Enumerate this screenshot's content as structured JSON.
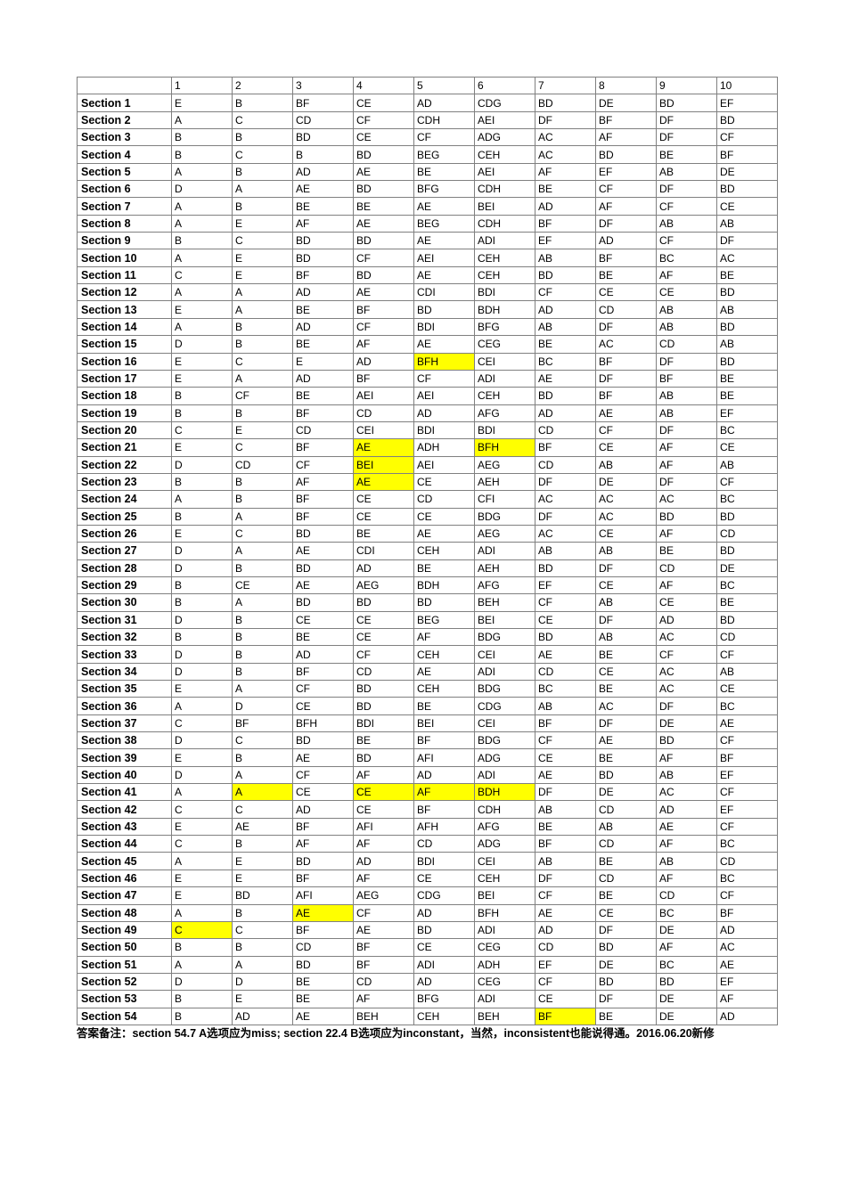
{
  "sheet": {
    "corner_label": "",
    "columns": [
      "1",
      "2",
      "3",
      "4",
      "5",
      "6",
      "7",
      "8",
      "9",
      "10"
    ],
    "highlight_color": "#ffff00",
    "rows": [
      {
        "label": "Section 1",
        "cells": [
          "E",
          "B",
          "BF",
          "CE",
          "AD",
          "CDG",
          "BD",
          "DE",
          "BD",
          "EF"
        ]
      },
      {
        "label": "Section 2",
        "cells": [
          "A",
          "C",
          "CD",
          "CF",
          "CDH",
          "AEI",
          "DF",
          "BF",
          "DF",
          "BD"
        ]
      },
      {
        "label": "Section 3",
        "cells": [
          "B",
          "B",
          "BD",
          "CE",
          "CF",
          "ADG",
          "AC",
          "AF",
          "DF",
          "CF"
        ]
      },
      {
        "label": "Section 4",
        "cells": [
          "B",
          "C",
          "B",
          "BD",
          "BEG",
          "CEH",
          "AC",
          "BD",
          "BE",
          "BF"
        ]
      },
      {
        "label": "Section 5",
        "cells": [
          "A",
          "B",
          "AD",
          "AE",
          "BE",
          "AEI",
          "AF",
          "EF",
          "AB",
          "DE"
        ]
      },
      {
        "label": "Section 6",
        "cells": [
          "D",
          "A",
          "AE",
          "BD",
          "BFG",
          "CDH",
          "BE",
          "CF",
          "DF",
          "BD"
        ]
      },
      {
        "label": "Section 7",
        "cells": [
          "A",
          "B",
          "BE",
          "BE",
          "AE",
          "BEI",
          "AD",
          "AF",
          "CF",
          "CE"
        ]
      },
      {
        "label": "Section 8",
        "cells": [
          "A",
          "E",
          "AF",
          "AE",
          "BEG",
          "CDH",
          "BF",
          "DF",
          "AB",
          "AB"
        ]
      },
      {
        "label": "Section 9",
        "cells": [
          "B",
          "C",
          "BD",
          "BD",
          "AE",
          "ADI",
          "EF",
          "AD",
          "CF",
          "DF"
        ]
      },
      {
        "label": "Section 10",
        "cells": [
          "A",
          "E",
          "BD",
          "CF",
          "AEI",
          "CEH",
          "AB",
          "BF",
          "BC",
          "AC"
        ]
      },
      {
        "label": "Section 11",
        "cells": [
          "C",
          "E",
          "BF",
          "BD",
          "AE",
          "CEH",
          "BD",
          "BE",
          "AF",
          "BE"
        ]
      },
      {
        "label": "Section 12",
        "cells": [
          "A",
          "A",
          "AD",
          "AE",
          "CDI",
          "BDI",
          "CF",
          "CE",
          "CE",
          "BD"
        ]
      },
      {
        "label": "Section 13",
        "cells": [
          "E",
          "A",
          "BE",
          "BF",
          "BD",
          "BDH",
          "AD",
          "CD",
          "AB",
          "AB"
        ]
      },
      {
        "label": "Section 14",
        "cells": [
          "A",
          "B",
          "AD",
          "CF",
          "BDI",
          "BFG",
          "AB",
          "DF",
          "AB",
          "BD"
        ]
      },
      {
        "label": "Section 15",
        "cells": [
          "D",
          "B",
          "BE",
          "AF",
          "AE",
          "CEG",
          "BE",
          "AC",
          "CD",
          "AB"
        ]
      },
      {
        "label": "Section 16",
        "cells": [
          "E",
          "C",
          "E",
          "AD",
          "BFH",
          "CEI",
          "BC",
          "BF",
          "DF",
          "BD"
        ]
      },
      {
        "label": "Section 17",
        "cells": [
          "E",
          "A",
          "AD",
          "BF",
          "CF",
          "ADI",
          "AE",
          "DF",
          "BF",
          "BE"
        ]
      },
      {
        "label": "Section 18",
        "cells": [
          "B",
          "CF",
          "BE",
          "AEI",
          "AEI",
          "CEH",
          "BD",
          "BF",
          "AB",
          "BE"
        ]
      },
      {
        "label": "Section 19",
        "cells": [
          "B",
          "B",
          "BF",
          "CD",
          "AD",
          "AFG",
          "AD",
          "AE",
          "AB",
          "EF"
        ]
      },
      {
        "label": "Section 20",
        "cells": [
          "C",
          "E",
          "CD",
          "CEI",
          "BDI",
          "BDI",
          "CD",
          "CF",
          "DF",
          "BC"
        ]
      },
      {
        "label": "Section 21",
        "cells": [
          "E",
          "C",
          "BF",
          "AE",
          "ADH",
          "BFH",
          "BF",
          "CE",
          "AF",
          "CE"
        ]
      },
      {
        "label": "Section 22",
        "cells": [
          "D",
          "CD",
          "CF",
          "BEI",
          "AEI",
          "AEG",
          "CD",
          "AB",
          "AF",
          "AB"
        ]
      },
      {
        "label": "Section 23",
        "cells": [
          "B",
          "B",
          "AF",
          "AE",
          "CE",
          "AEH",
          "DF",
          "DE",
          "DF",
          "CF"
        ]
      },
      {
        "label": "Section 24",
        "cells": [
          "A",
          "B",
          "BF",
          "CE",
          "CD",
          "CFI",
          "AC",
          "AC",
          "AC",
          "BC"
        ]
      },
      {
        "label": "Section 25",
        "cells": [
          "B",
          "A",
          "BF",
          "CE",
          "CE",
          "BDG",
          "DF",
          "AC",
          "BD",
          "BD"
        ]
      },
      {
        "label": "Section 26",
        "cells": [
          "E",
          "C",
          "BD",
          "BE",
          "AE",
          "AEG",
          "AC",
          "CE",
          "AF",
          "CD"
        ]
      },
      {
        "label": "Section 27",
        "cells": [
          "D",
          "A",
          "AE",
          "CDI",
          "CEH",
          "ADI",
          "AB",
          "AB",
          "BE",
          "BD"
        ]
      },
      {
        "label": "Section 28",
        "cells": [
          "D",
          "B",
          "BD",
          "AD",
          "BE",
          "AEH",
          "BD",
          "DF",
          "CD",
          "DE"
        ]
      },
      {
        "label": "Section 29",
        "cells": [
          "B",
          "CE",
          "AE",
          "AEG",
          "BDH",
          "AFG",
          "EF",
          "CE",
          "AF",
          "BC"
        ]
      },
      {
        "label": "Section 30",
        "cells": [
          "B",
          "A",
          "BD",
          "BD",
          "BD",
          "BEH",
          "CF",
          "AB",
          "CE",
          "BE"
        ]
      },
      {
        "label": "Section 31",
        "cells": [
          "D",
          "B",
          "CE",
          "CE",
          "BEG",
          "BEI",
          "CE",
          "DF",
          "AD",
          "BD"
        ]
      },
      {
        "label": "Section 32",
        "cells": [
          "B",
          "B",
          "BE",
          "CE",
          "AF",
          "BDG",
          "BD",
          "AB",
          "AC",
          "CD"
        ]
      },
      {
        "label": "Section 33",
        "cells": [
          "D",
          "B",
          "AD",
          "CF",
          "CEH",
          "CEI",
          "AE",
          "BE",
          "CF",
          "CF"
        ]
      },
      {
        "label": "Section 34",
        "cells": [
          "D",
          "B",
          "BF",
          "CD",
          "AE",
          "ADI",
          "CD",
          "CE",
          "AC",
          "AB"
        ]
      },
      {
        "label": "Section 35",
        "cells": [
          "E",
          "A",
          "CF",
          "BD",
          "CEH",
          "BDG",
          "BC",
          "BE",
          "AC",
          "CE"
        ]
      },
      {
        "label": "Section 36",
        "cells": [
          "A",
          "D",
          "CE",
          "BD",
          "BE",
          "CDG",
          "AB",
          "AC",
          "DF",
          "BC"
        ]
      },
      {
        "label": "Section 37",
        "cells": [
          "C",
          "BF",
          "BFH",
          "BDI",
          "BEI",
          "CEI",
          "BF",
          "DF",
          "DE",
          "AE"
        ]
      },
      {
        "label": "Section 38",
        "cells": [
          "D",
          "C",
          "BD",
          "BE",
          "BF",
          "BDG",
          "CF",
          "AE",
          "BD",
          "CF"
        ]
      },
      {
        "label": "Section 39",
        "cells": [
          "E",
          "B",
          "AE",
          "BD",
          "AFI",
          "ADG",
          "CE",
          "BE",
          "AF",
          "BF"
        ]
      },
      {
        "label": "Section 40",
        "cells": [
          "D",
          "A",
          "CF",
          "AF",
          "AD",
          "ADI",
          "AE",
          "BD",
          "AB",
          "EF"
        ]
      },
      {
        "label": "Section 41",
        "cells": [
          "A",
          "A",
          "CE",
          "CE",
          "AF",
          "BDH",
          "DF",
          "DE",
          "AC",
          "CF"
        ]
      },
      {
        "label": "Section 42",
        "cells": [
          "C",
          "C",
          "AD",
          "CE",
          "BF",
          "CDH",
          "AB",
          "CD",
          "AD",
          "EF"
        ]
      },
      {
        "label": "Section 43",
        "cells": [
          "E",
          "AE",
          "BF",
          "AFI",
          "AFH",
          "AFG",
          "BE",
          "AB",
          "AE",
          "CF"
        ]
      },
      {
        "label": "Section 44",
        "cells": [
          "C",
          "B",
          "AF",
          "AF",
          "CD",
          "ADG",
          "BF",
          "CD",
          "AF",
          "BC"
        ]
      },
      {
        "label": "Section 45",
        "cells": [
          "A",
          "E",
          "BD",
          "AD",
          "BDI",
          "CEI",
          "AB",
          "BE",
          "AB",
          "CD"
        ]
      },
      {
        "label": "Section 46",
        "cells": [
          "E",
          "E",
          "BF",
          "AF",
          "CE",
          "CEH",
          "DF",
          "CD",
          "AF",
          "BC"
        ]
      },
      {
        "label": "Section 47",
        "cells": [
          "E",
          "BD",
          "AFI",
          "AEG",
          "CDG",
          "BEI",
          "CF",
          "BE",
          "CD",
          "CF"
        ]
      },
      {
        "label": "Section 48",
        "cells": [
          "A",
          "B",
          "AE",
          "CF",
          "AD",
          "BFH",
          "AE",
          "CE",
          "BC",
          "BF"
        ]
      },
      {
        "label": "Section 49",
        "cells": [
          "C",
          "C",
          "BF",
          "AE",
          "BD",
          "ADI",
          "AD",
          "DF",
          "DE",
          "AD"
        ]
      },
      {
        "label": "Section 50",
        "cells": [
          "B",
          "B",
          "CD",
          "BF",
          "CE",
          "CEG",
          "CD",
          "BD",
          "AF",
          "AC"
        ]
      },
      {
        "label": "Section 51",
        "cells": [
          "A",
          "A",
          "BD",
          "BF",
          "ADI",
          "ADH",
          "EF",
          "DE",
          "BC",
          "AE"
        ]
      },
      {
        "label": "Section 52",
        "cells": [
          "D",
          "D",
          "BE",
          "CD",
          "AD",
          "CEG",
          "CF",
          "BD",
          "BD",
          "EF"
        ]
      },
      {
        "label": "Section 53",
        "cells": [
          "B",
          "E",
          "BE",
          "AF",
          "BFG",
          "ADI",
          "CE",
          "DF",
          "DE",
          "AF"
        ]
      },
      {
        "label": "Section 54",
        "cells": [
          "B",
          "AD",
          "AE",
          "BEH",
          "CEH",
          "BEH",
          "BF",
          "BE",
          "DE",
          "AD"
        ]
      }
    ],
    "highlights": [
      {
        "row": 16,
        "col": 5
      },
      {
        "row": 21,
        "col": 4
      },
      {
        "row": 21,
        "col": 6
      },
      {
        "row": 22,
        "col": 4
      },
      {
        "row": 23,
        "col": 4
      },
      {
        "row": 41,
        "col": 2
      },
      {
        "row": 41,
        "col": 4
      },
      {
        "row": 41,
        "col": 5
      },
      {
        "row": 41,
        "col": 6
      },
      {
        "row": 48,
        "col": 3
      },
      {
        "row": 49,
        "col": 1
      },
      {
        "row": 54,
        "col": 7
      }
    ]
  },
  "footnote": {
    "text": "答案备注：section 54.7 A选项应为miss; section 22.4 B选项应为inconstant，当然，inconsistent也能说得通。2016.06.20新修"
  }
}
